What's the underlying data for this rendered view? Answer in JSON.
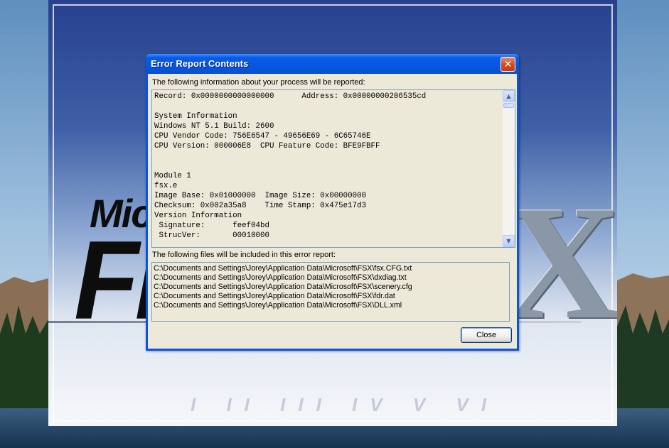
{
  "background": {
    "logo_line1": "Micr",
    "logo_line2": "Flig",
    "logo_x": "X",
    "roman_numerals": "I II III IV V VI"
  },
  "dialog": {
    "title": "Error Report Contents",
    "close_glyph": "✕",
    "info_label": "The following information about your process will be reported:",
    "info_lines": [
      "Record: 0x0000000000000000      Address: 0x00000000206535cd",
      "",
      "System Information",
      "Windows NT 5.1 Build: 2600",
      "CPU Vendor Code: 756E6547 - 49656E69 - 6C65746E",
      "CPU Version: 000006E8  CPU Feature Code: BFE9FBFF",
      "",
      "",
      "Module 1",
      "fsx.e",
      "Image Base: 0x01000000  Image Size: 0x00000000",
      "Checksum: 0x002a35a8    Time Stamp: 0x475e17d3",
      "Version Information",
      " Signature:      feef04bd",
      " StrucVer:       00010000"
    ],
    "files_label": "The following files will be included in this error report:",
    "files": [
      "C:\\Documents and Settings\\Jorey\\Application Data\\Microsoft\\FSX\\fsx.CFG.txt",
      "C:\\Documents and Settings\\Jorey\\Application Data\\Microsoft\\FSX\\dxdiag.txt",
      "C:\\Documents and Settings\\Jorey\\Application Data\\Microsoft\\FSX\\scenery.cfg",
      "C:\\Documents and Settings\\Jorey\\Application Data\\Microsoft\\FSX\\fdr.dat",
      "C:\\Documents and Settings\\Jorey\\Application Data\\Microsoft\\FSX\\DLL.xml"
    ],
    "close_label": "Close",
    "scroll_up_glyph": "▲",
    "scroll_down_glyph": "▼"
  },
  "colors": {
    "titlebar": "#0558e0",
    "dialog_face": "#ece9d8",
    "close_x": "#d64c24"
  }
}
